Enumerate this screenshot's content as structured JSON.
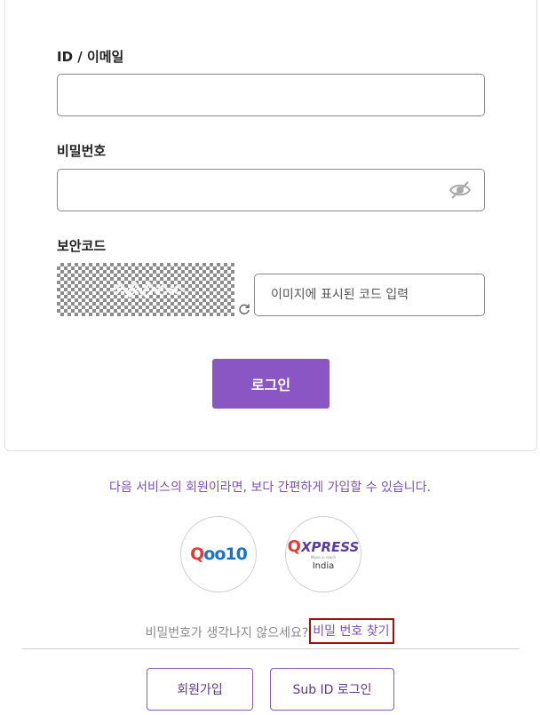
{
  "login_form": {
    "id_label": "ID / 이메일",
    "id_value": "",
    "password_label": "비밀번호",
    "password_value": "",
    "password_toggle_icon": "eye-slash-icon",
    "captcha_label": "보안코드",
    "captcha_refresh_icon": "refresh-icon",
    "captcha_input_placeholder": "이미지에 표시된 코드 입력",
    "login_button_label": "로그인"
  },
  "social": {
    "promo_text": "다음 서비스의 회원이라면, 보다 간편하게 가입할 수 있습니다.",
    "qoo10": {
      "q": "Q",
      "rest": "oo10"
    },
    "qxpress": {
      "q": "Q",
      "rest": "XPRESS",
      "tagline": "Move in reach",
      "region": "India"
    }
  },
  "footer": {
    "forgot_prompt": "비밀번호가 생각나지 않으세요?",
    "forgot_link": "비밀 번호 찾기",
    "signup_button": "회원가입",
    "subid_button": "Sub ID 로그인"
  },
  "colors": {
    "accent": "#8a56c4",
    "link_highlight_border": "#a01010",
    "qoo10_red": "#e53935",
    "qoo10_blue": "#1e73c8"
  }
}
